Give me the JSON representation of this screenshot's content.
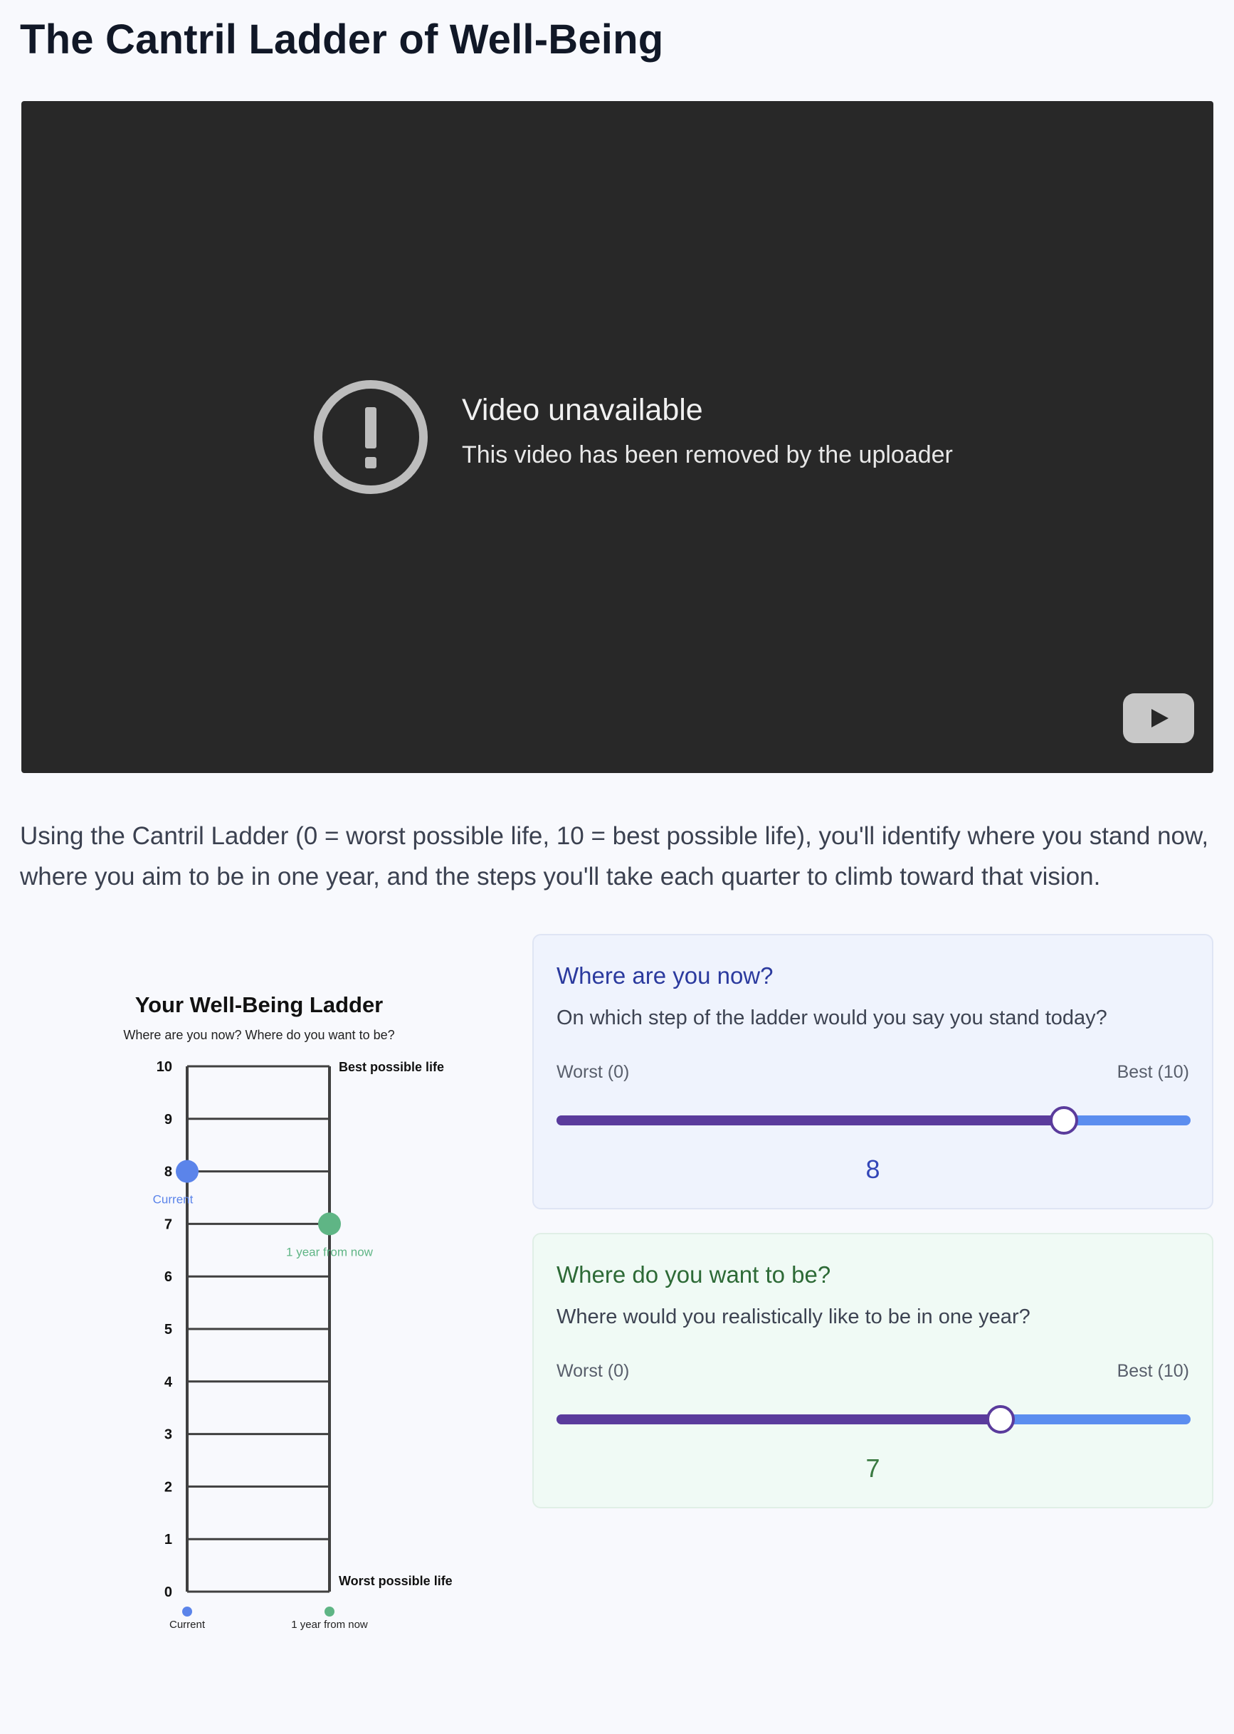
{
  "page": {
    "title": "The Cantril Ladder of Well-Being"
  },
  "video": {
    "error_title": "Video unavailable",
    "error_message": "This video has been removed by the uploader",
    "icons": [
      "alert-circle-icon",
      "youtube-play-icon"
    ]
  },
  "intro": "Using the Cantril Ladder (0 = worst possible life, 10 = best possible life), you'll identify where you stand now, where you aim to be in one year, and the steps you'll take each quarter to climb toward that vision.",
  "ladder": {
    "title": "Your Well-Being Ladder",
    "subtitle": "Where are you now? Where do you want to be?",
    "top_label": "Best possible life",
    "bottom_label": "Worst possible life",
    "steps": [
      0,
      1,
      2,
      3,
      4,
      5,
      6,
      7,
      8,
      9,
      10
    ],
    "current_marker_label": "Current",
    "goal_marker_label": "1 year from now",
    "legend": [
      "Current",
      "1 year from now"
    ],
    "colors": {
      "current": "#5b84ea",
      "goal": "#5fb585",
      "rails": "#404040"
    }
  },
  "chart_data": {
    "type": "scatter",
    "title": "Your Well-Being Ladder",
    "subtitle": "Where are you now? Where do you want to be?",
    "ylim": [
      0,
      10
    ],
    "series": [
      {
        "name": "Current",
        "values": [
          8
        ]
      },
      {
        "name": "1 year from now",
        "values": [
          7
        ]
      }
    ]
  },
  "now_card": {
    "heading": "Where are you now?",
    "question": "On which step of the ladder would you say you stand today?",
    "min_label": "Worst (0)",
    "max_label": "Best (10)",
    "value": 8,
    "value_text": "8"
  },
  "goal_card": {
    "heading": "Where do you want to be?",
    "question": "Where would you realistically like to be in one year?",
    "min_label": "Worst (0)",
    "max_label": "Best (10)",
    "value": 7,
    "value_text": "7"
  }
}
